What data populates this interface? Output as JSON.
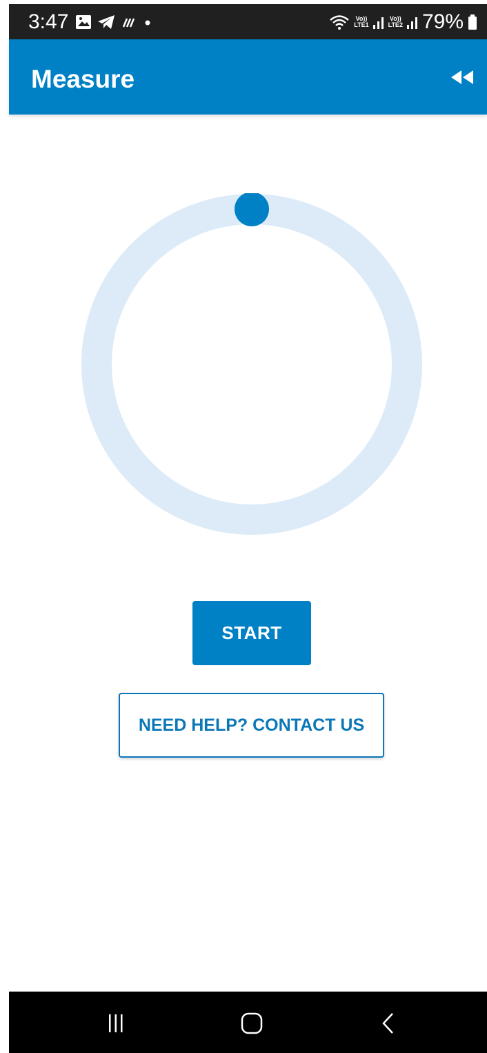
{
  "status_bar": {
    "time": "3:47",
    "battery": "79%",
    "left_icons": [
      "gallery-icon",
      "telegram-icon",
      "data-saver-icon",
      "dot-icon"
    ],
    "network_labels": [
      "Vo))",
      "LTE1",
      "Vo))",
      "LTE2"
    ]
  },
  "app_bar": {
    "title": "Measure",
    "action_icon": "rewind-icon"
  },
  "dial": {
    "ring_color": "#dcebf7",
    "knob_color": "#0081c6",
    "progress_fraction": 0
  },
  "actions": {
    "start_label": "START",
    "help_label": "NEED HELP? CONTACT US"
  },
  "nav_bar": {
    "recents_icon": "recents-icon",
    "home_icon": "home-icon",
    "back_icon": "back-icon"
  },
  "colors": {
    "primary": "#0081c6",
    "status_bar": "#202020"
  }
}
